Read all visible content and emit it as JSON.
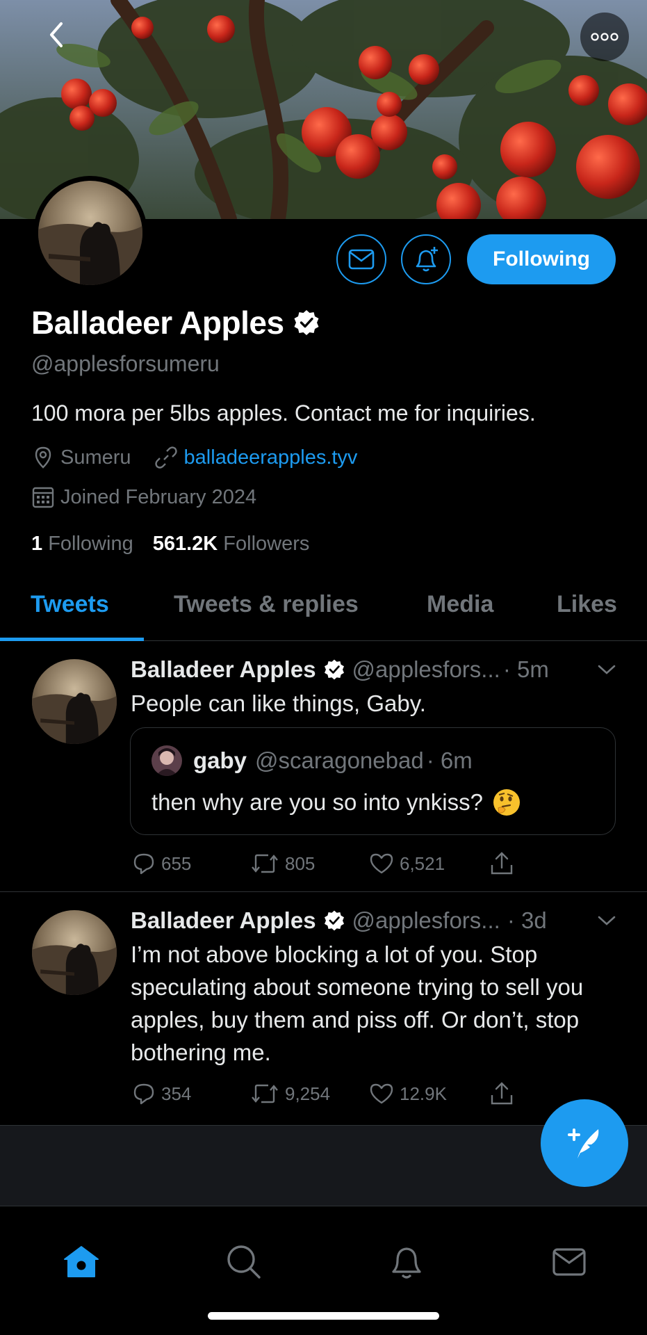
{
  "profile": {
    "name": "Balladeer Apples",
    "handle": "@applesforsumeru",
    "bio": "100 mora per 5lbs apples. Contact me for inquiries.",
    "location": "Sumeru",
    "website": "balladeerapples.tyv",
    "joined": "Joined February 2024",
    "following_count": "1",
    "following_label": "Following",
    "followers_count": "561.2K",
    "followers_label": "Followers",
    "follow_button": "Following"
  },
  "tabs": [
    "Tweets",
    "Tweets & replies",
    "Media",
    "Likes"
  ],
  "tweets": [
    {
      "name": "Balladeer Apples",
      "handle": "@applesfors...",
      "time": "· 5m",
      "text": "People can like things, Gaby.",
      "quote": {
        "name": "gaby",
        "handle": "@scaragonebad",
        "time": "· 6m",
        "text": "then why are you so into ynkiss?",
        "emoji": "thinking-face"
      },
      "replies": "655",
      "retweets": "805",
      "likes": "6,521"
    },
    {
      "name": "Balladeer Apples",
      "handle": "@applesfors...",
      "time": "· 3d",
      "text": "I’m not above blocking a lot of you. Stop speculating about someone trying to sell you apples, buy them and piss off. Or don’t, stop bothering me.",
      "replies": "354",
      "retweets": "9,254",
      "likes": "12.9K"
    }
  ],
  "colors": {
    "accent": "#1d9bf0",
    "background": "#000000",
    "muted": "#71767b",
    "divider": "#2f3336"
  },
  "icons": {
    "header": [
      "back-arrow-icon",
      "more-icon"
    ],
    "profile_actions": [
      "message-icon",
      "notify-icon"
    ],
    "bottom_nav": [
      "home-icon",
      "search-icon",
      "notifications-icon",
      "messages-icon"
    ],
    "fab": "compose-tweet-icon"
  }
}
